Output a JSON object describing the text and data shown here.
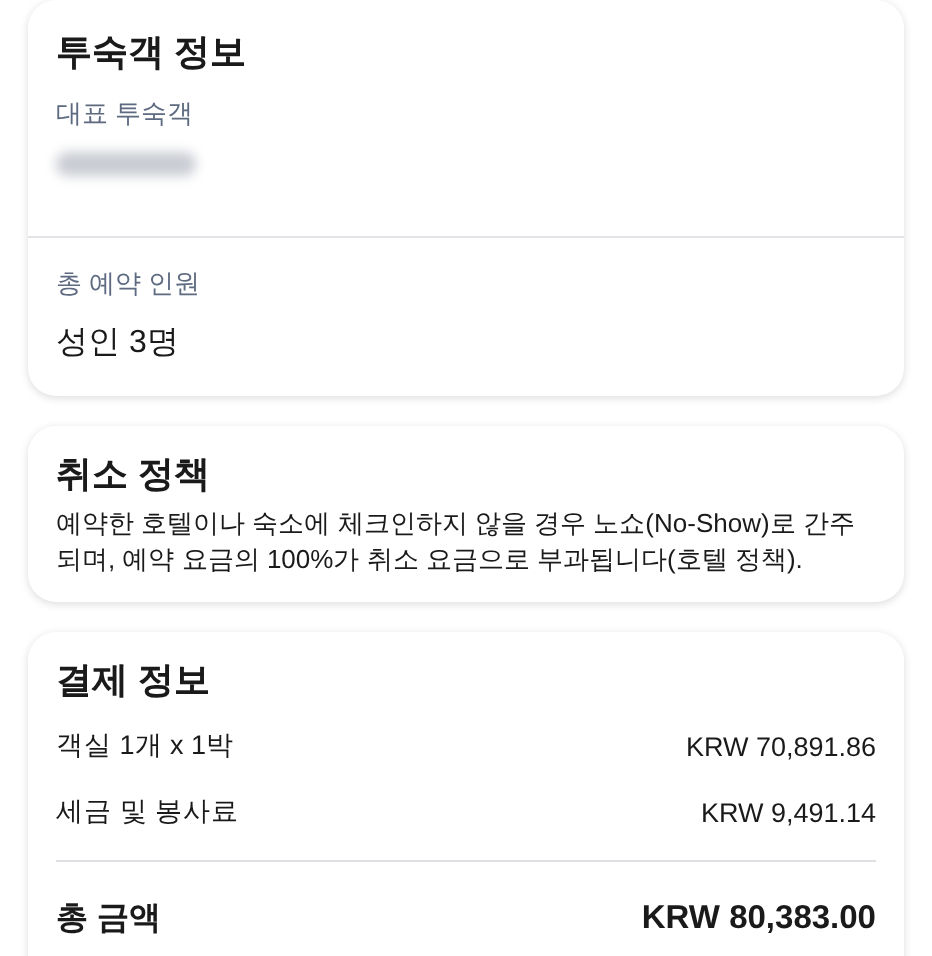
{
  "guest_info": {
    "title": "투숙객 정보",
    "primary_guest": {
      "label": "대표 투숙객"
    },
    "total_guests": {
      "label": "총 예약 인원",
      "value": "성인 3명"
    }
  },
  "cancellation_policy": {
    "title": "취소 정책",
    "text": "예약한 호텔이나 숙소에 체크인하지 않을 경우 노쇼(No-Show)로 간주되며, 예약 요금의 100%가 취소 요금으로 부과됩니다(호텔 정책)."
  },
  "payment_info": {
    "title": "결제 정보",
    "items": [
      {
        "label": "객실 1개 x 1박",
        "amount": "KRW 70,891.86"
      },
      {
        "label": "세금 및 봉사료",
        "amount": "KRW 9,491.14"
      }
    ],
    "total": {
      "label": "총 금액",
      "amount": "KRW 80,383.00"
    }
  }
}
